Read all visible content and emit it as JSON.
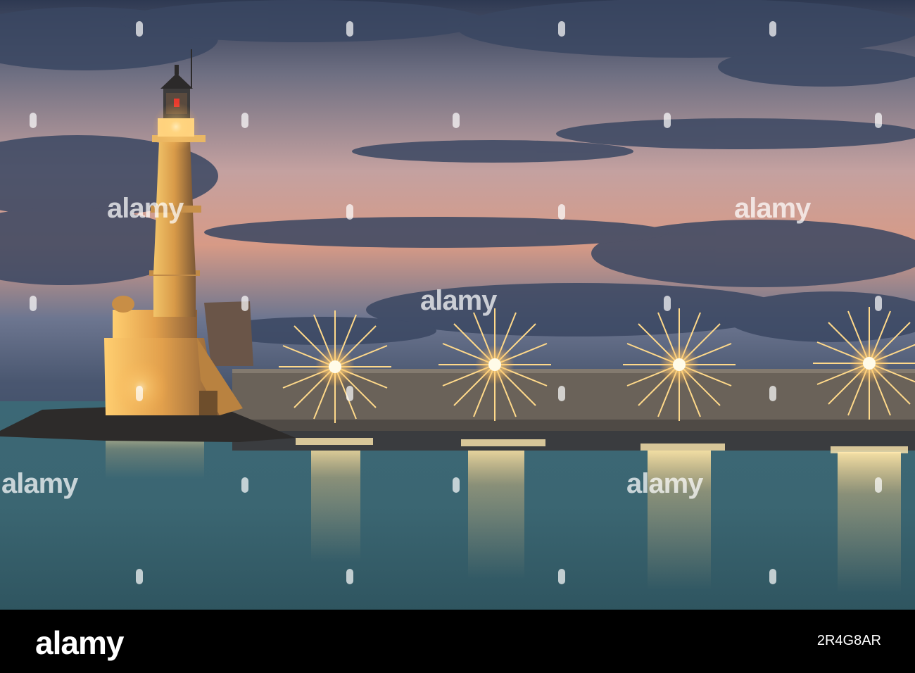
{
  "watermark": {
    "text": "alamy"
  },
  "footer": {
    "logo": "alamy",
    "image_id": "2R4G8AR",
    "tagline": ""
  },
  "colors": {
    "sky_top": "#2c3750",
    "sky_glow": "#e3a37e",
    "water": "#3f6a75",
    "lamp": "#ffd37a",
    "lighthouse": "#e2a54f"
  }
}
